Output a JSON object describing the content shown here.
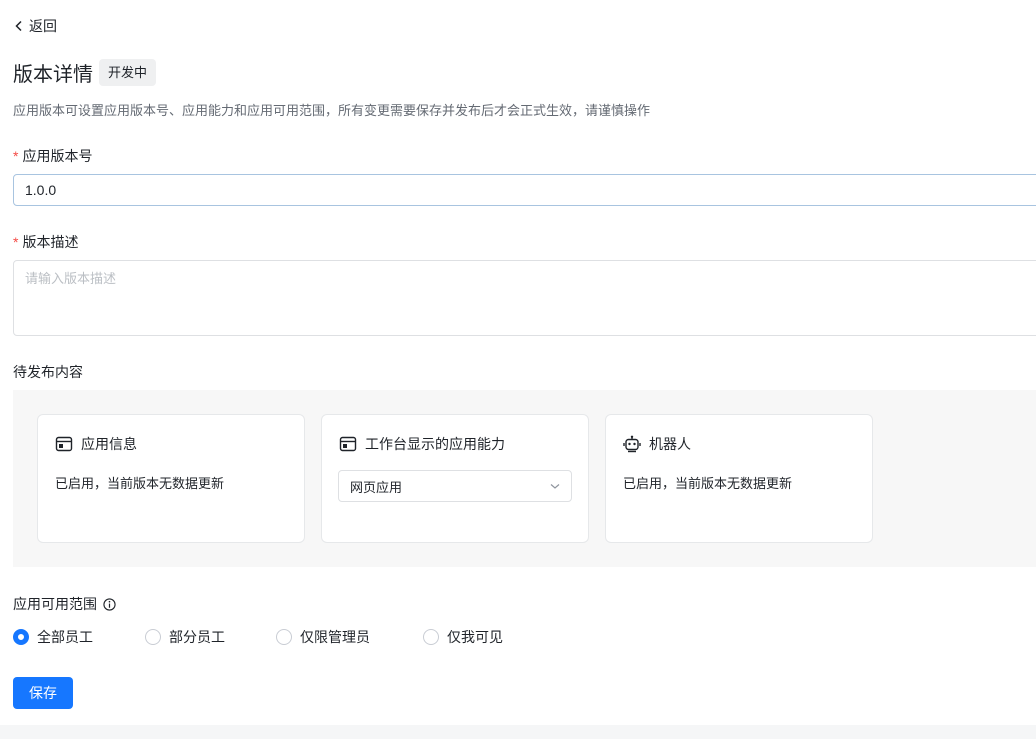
{
  "header": {
    "back_label": "返回",
    "title": "版本详情",
    "status": "开发中",
    "description": "应用版本可设置应用版本号、应用能力和应用可用范围，所有变更需要保存并发布后才会正式生效，请谨慎操作"
  },
  "form": {
    "version": {
      "label": "应用版本号",
      "value": "1.0.0"
    },
    "description": {
      "label": "版本描述",
      "placeholder": "请输入版本描述"
    }
  },
  "pending": {
    "label": "待发布内容",
    "cards": [
      {
        "title": "应用信息",
        "icon": "window-icon",
        "text": "已启用，当前版本无数据更新"
      },
      {
        "title": "工作台显示的应用能力",
        "icon": "window-icon",
        "select_value": "网页应用"
      },
      {
        "title": "机器人",
        "icon": "robot-icon",
        "text": "已启用，当前版本无数据更新"
      }
    ]
  },
  "scope": {
    "label": "应用可用范围",
    "options": [
      {
        "label": "全部员工",
        "checked": true
      },
      {
        "label": "部分员工",
        "checked": false
      },
      {
        "label": "仅限管理员",
        "checked": false
      },
      {
        "label": "仅我可见",
        "checked": false
      }
    ]
  },
  "actions": {
    "save_label": "保存"
  },
  "colors": {
    "primary": "#1677ff",
    "required": "#f54a45"
  }
}
